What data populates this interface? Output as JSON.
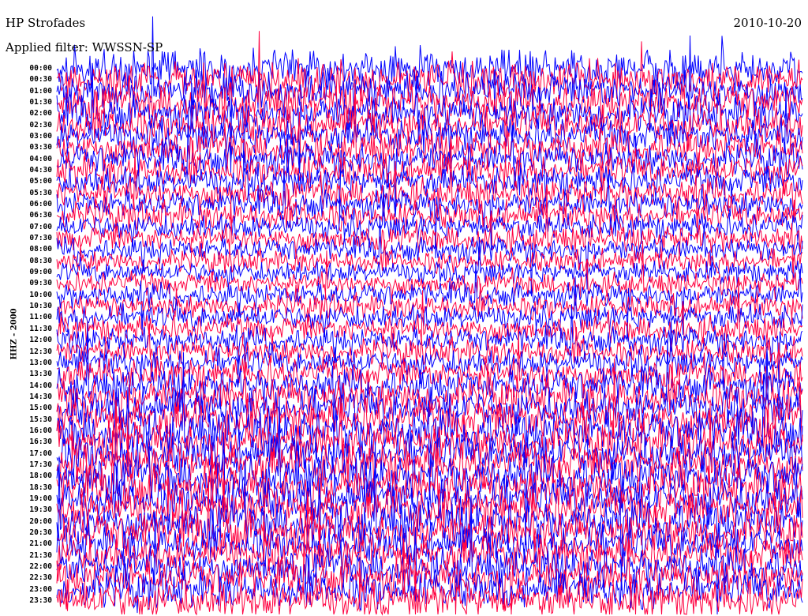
{
  "chart_data": {
    "type": "line",
    "title": "HP Strofades",
    "date": "2010-10-20",
    "filter_label": "Applied filter: WWSSN-SP",
    "ylabel": "HHZ - 2000",
    "row_labels": [
      "00:00",
      "00:30",
      "01:00",
      "01:30",
      "02:00",
      "02:30",
      "03:00",
      "03:30",
      "04:00",
      "04:30",
      "05:00",
      "05:30",
      "06:00",
      "06:30",
      "07:00",
      "07:30",
      "08:00",
      "08:30",
      "09:00",
      "09:30",
      "10:00",
      "10:30",
      "11:00",
      "11:30",
      "12:00",
      "12:30",
      "13:00",
      "13:30",
      "14:00",
      "14:30",
      "15:00",
      "15:30",
      "16:00",
      "16:30",
      "17:00",
      "17:30",
      "18:00",
      "18:30",
      "19:00",
      "19:30",
      "20:00",
      "20:30",
      "21:00",
      "21:30",
      "22:00",
      "22:30",
      "23:00",
      "23:30"
    ],
    "row_colors": [
      "#0000ff",
      "#ff0040"
    ],
    "relative_noise_level": [
      1.0,
      1.0,
      1.0,
      1.0,
      0.95,
      0.95,
      0.9,
      0.9,
      0.85,
      0.85,
      0.8,
      0.8,
      0.75,
      0.75,
      0.7,
      0.7,
      0.65,
      0.6,
      0.6,
      0.6,
      0.65,
      0.65,
      0.7,
      0.7,
      0.7,
      0.7,
      0.75,
      0.8,
      0.9,
      1.0,
      1.0,
      1.1,
      1.1,
      1.1,
      1.1,
      1.1,
      1.1,
      1.1,
      1.1,
      1.1,
      1.1,
      1.1,
      1.0,
      1.0,
      1.0,
      1.0,
      1.0,
      1.0
    ]
  }
}
